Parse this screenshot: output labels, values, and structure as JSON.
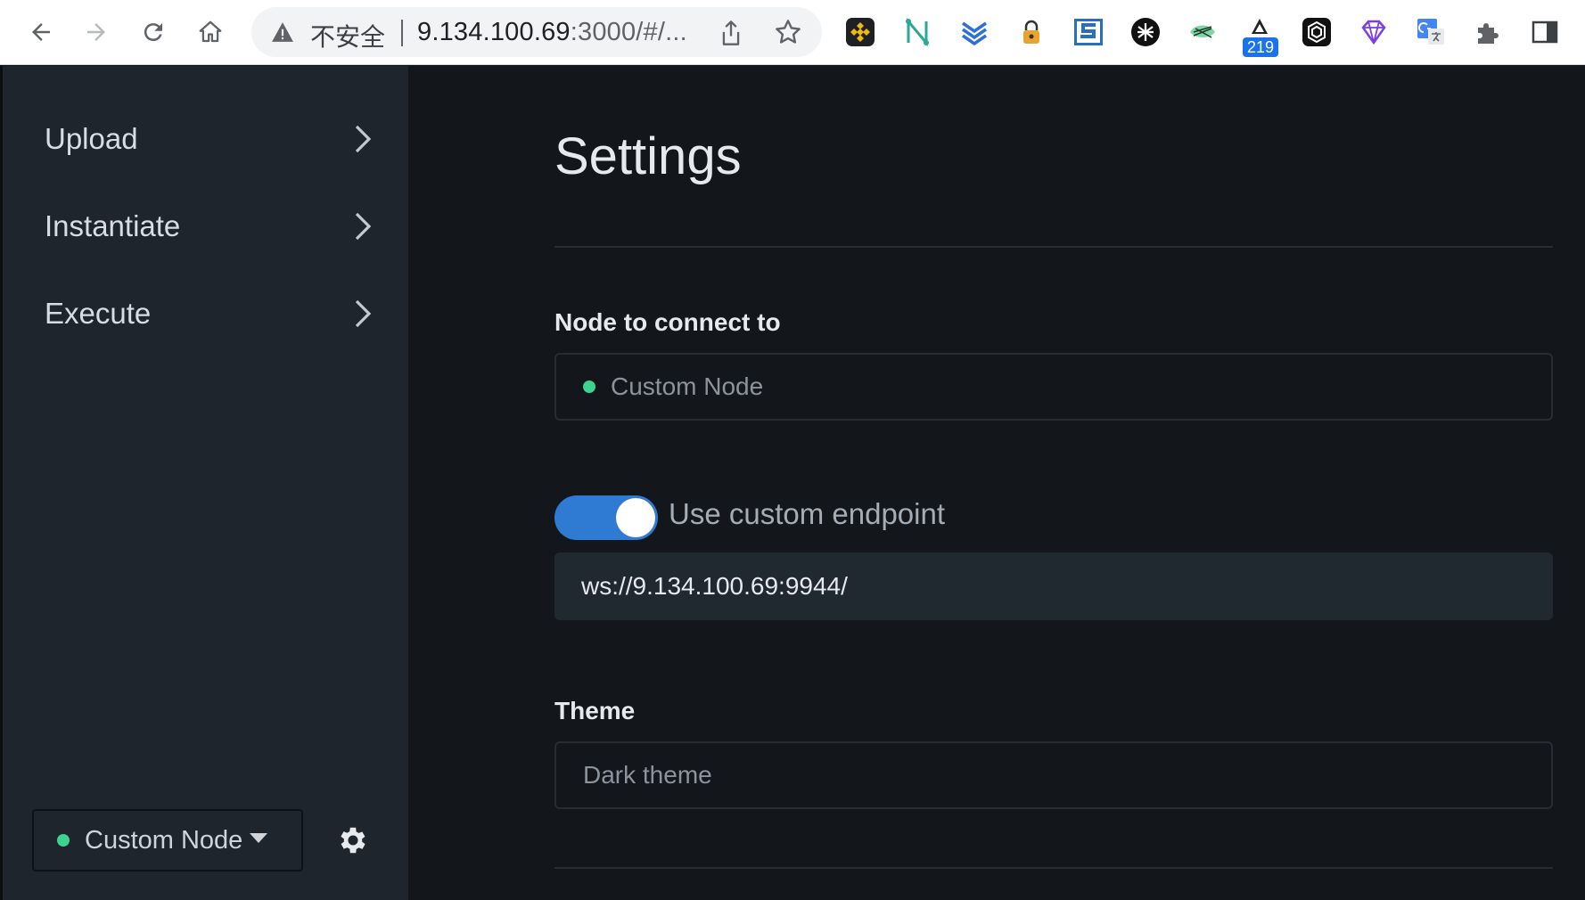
{
  "browser": {
    "insecure_label": "不安全",
    "url_host": "9.134.100.69",
    "url_rest": ":3000/#/...",
    "extension_badge": "219",
    "extensions": [
      "binance-wallet-icon",
      "n-extension-icon",
      "layers-extension-icon",
      "lock-extension-icon",
      "s-extension-icon",
      "crypto-wallet-icon",
      "mask-extension-icon",
      "sail-extension-icon",
      "polkadot-extension-icon",
      "gem-extension-icon",
      "google-translate-icon",
      "extensions-puzzle-icon",
      "side-panel-icon"
    ]
  },
  "sidebar": {
    "items": [
      {
        "label": "Upload"
      },
      {
        "label": "Instantiate"
      },
      {
        "label": "Execute"
      }
    ],
    "node_selector": {
      "label": "Custom Node",
      "status_color": "#3ed291"
    }
  },
  "main": {
    "title": "Settings",
    "node_label": "Node to connect to",
    "node_select_value": "Custom Node",
    "custom_endpoint_label": "Use custom endpoint",
    "custom_endpoint_enabled": true,
    "endpoint_value": "ws://9.134.100.69:9944/",
    "theme_label": "Theme",
    "theme_value": "Dark theme"
  },
  "colors": {
    "accent": "#2f7ad3",
    "status_green": "#3ed291",
    "sidebar_bg": "#1e252d",
    "main_bg": "#13171c"
  }
}
